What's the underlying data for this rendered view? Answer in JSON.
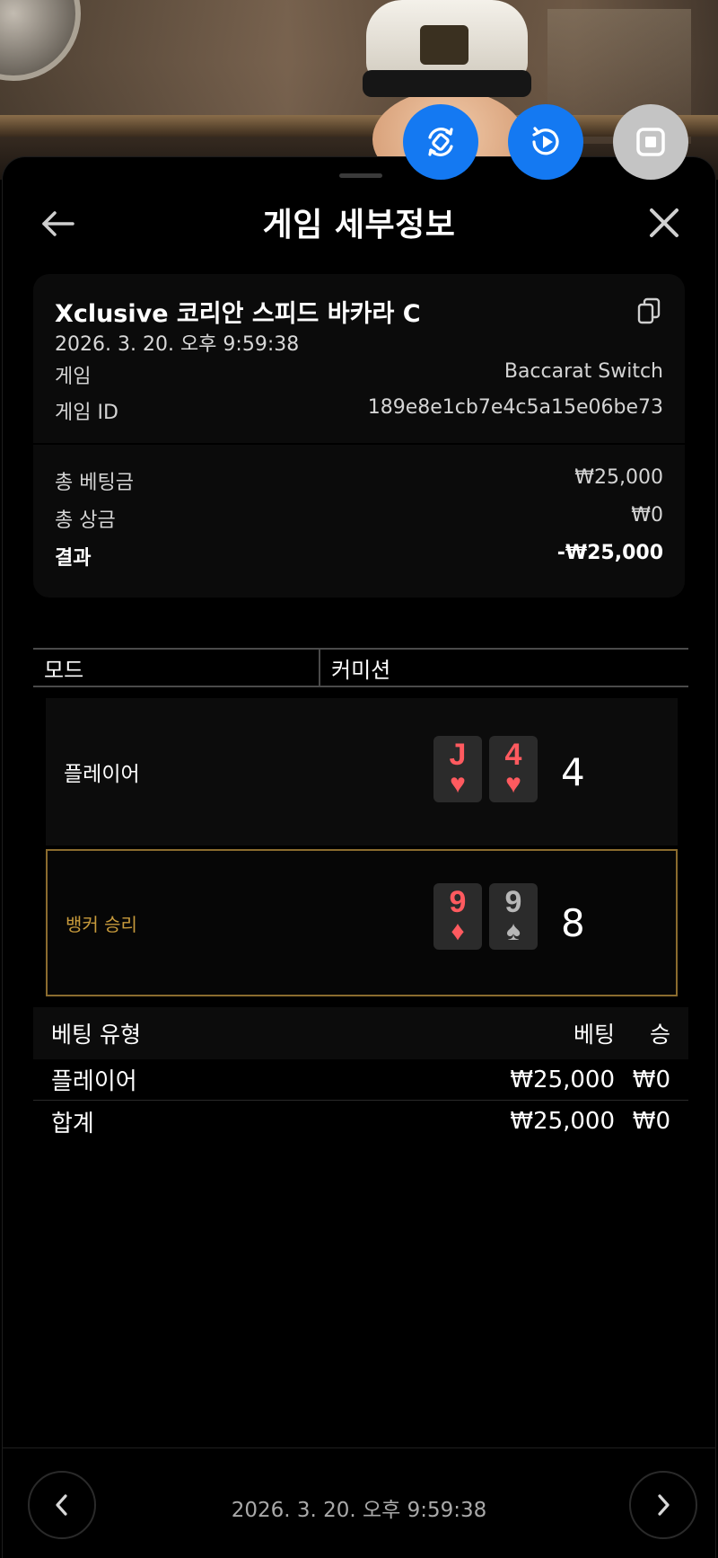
{
  "video_controls": {
    "icons": [
      "rotate-screen-icon",
      "replay-icon",
      "stop-icon"
    ],
    "colors": {
      "primary": "#1479f2",
      "neutral": "#c4c4c4"
    }
  },
  "header": {
    "title": "게임 세부정보",
    "back_icon": "arrow-left-icon",
    "close_icon": "close-icon"
  },
  "game": {
    "table_name": "Xclusive 코리안 스피드 바카라 C",
    "date": "2026. 3. 20. 오후 9:59:38",
    "game_label": "게임",
    "game_value": "Baccarat Switch",
    "id_label": "게임 ID",
    "id_value": "189e8e1cb7e4c5a15e06be73",
    "copy_icon": "copy-icon"
  },
  "summary": {
    "total_bet_label": "총 베팅금",
    "total_bet_value": "₩25,000",
    "total_win_label": "총 상금",
    "total_win_value": "₩0",
    "result_label": "결과",
    "result_value": "-₩25,000"
  },
  "mode_header": {
    "mode": "모드",
    "commission": "커미션"
  },
  "hands": {
    "player": {
      "label": "플레이어",
      "cards": [
        {
          "rank": "J",
          "suit": "♥",
          "color": "red"
        },
        {
          "rank": "4",
          "suit": "♥",
          "color": "red"
        }
      ],
      "score": "4"
    },
    "banker": {
      "label": "뱅커 승리",
      "cards": [
        {
          "rank": "9",
          "suit": "♦",
          "color": "red"
        },
        {
          "rank": "9",
          "suit": "♠",
          "color": "black"
        }
      ],
      "score": "8",
      "highlight_color": "#c89b3c"
    }
  },
  "bets": {
    "columns": {
      "type": "베팅 유형",
      "bet": "베팅",
      "win": "승"
    },
    "rows": [
      {
        "type": "플레이어",
        "bet": "₩25,000",
        "win": "₩0"
      }
    ],
    "total": {
      "type": "합계",
      "bet": "₩25,000",
      "win": "₩0"
    }
  },
  "footer": {
    "date": "2026. 3. 20. 오후 9:59:38",
    "prev_icon": "chevron-left-icon",
    "next_icon": "chevron-right-icon"
  }
}
